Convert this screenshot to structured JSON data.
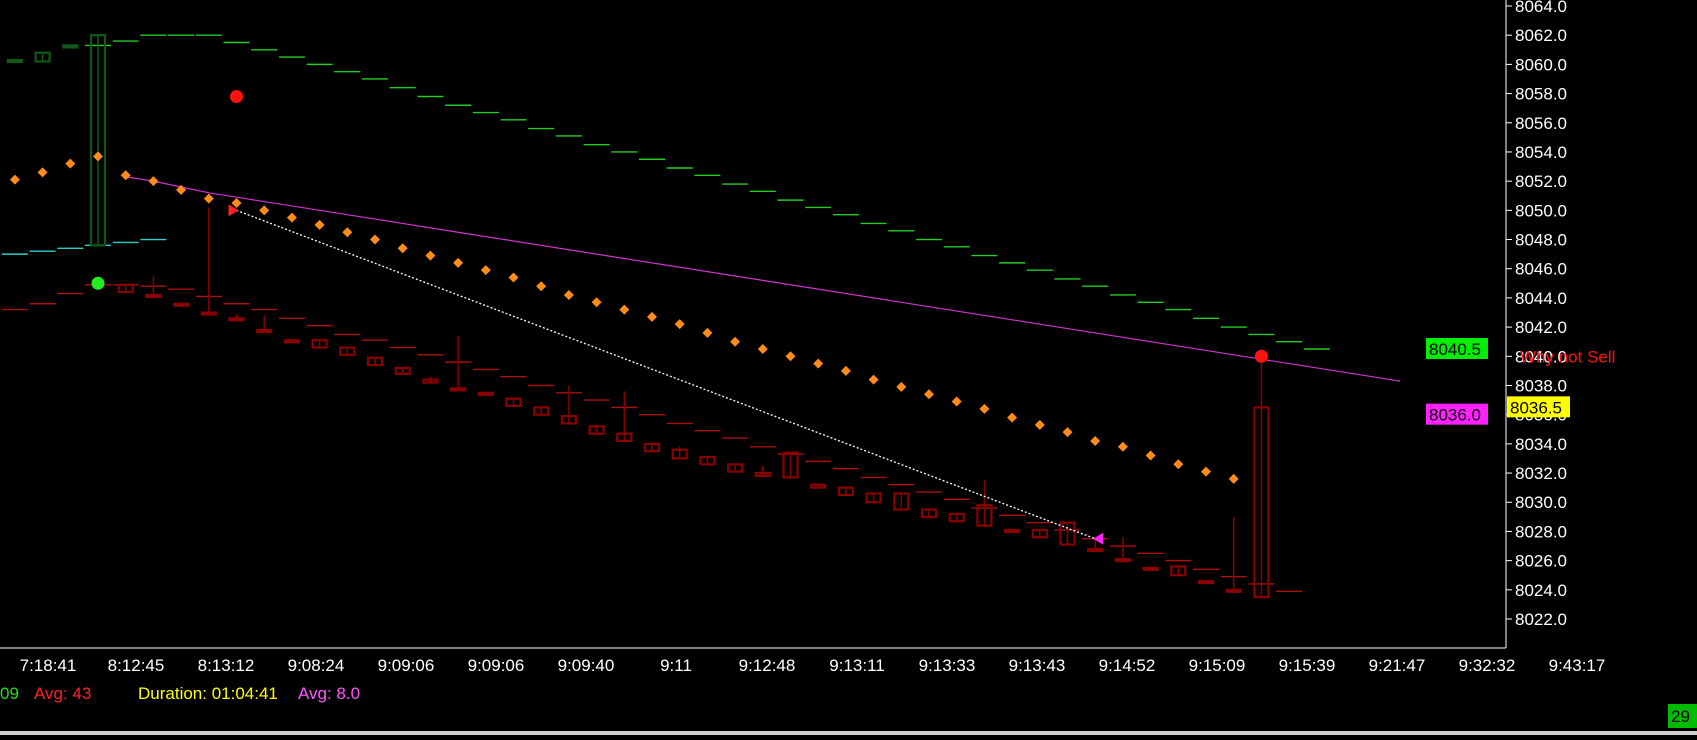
{
  "chart_data": {
    "type": "candlestick",
    "ylim": [
      8021,
      8065
    ],
    "y_ticks": [
      "8022.0",
      "8024.0",
      "8026.0",
      "8028.0",
      "8030.0",
      "8032.0",
      "8034.0",
      "8036.0",
      "8038.0",
      "8040.0",
      "8042.0",
      "8044.0",
      "8046.0",
      "8048.0",
      "8050.0",
      "8052.0",
      "8054.0",
      "8056.0",
      "8058.0",
      "8060.0",
      "8062.0",
      "8064.0"
    ],
    "x_ticks": [
      "7:18:41",
      "8:12:45",
      "8:13:12",
      "9:08:24",
      "9:09:06",
      "9:09:06",
      "9:09:40",
      "9:11",
      "9:12:48",
      "9:13:11",
      "9:13:33",
      "9:13:43",
      "9:14:52",
      "9:15:09",
      "9:15:39",
      "9:21:47",
      "9:32:32",
      "9:43:17"
    ],
    "bars": [
      {
        "o": 8060.3,
        "h": 8060.3,
        "l": 8060.3,
        "c": 8060.3,
        "color": "#0f5a18"
      },
      {
        "o": 8060.2,
        "h": 8060.8,
        "l": 8060.2,
        "c": 8060.8,
        "color": "#0f5a18"
      },
      {
        "o": 8061.3,
        "h": 8061.3,
        "l": 8061.3,
        "c": 8061.3,
        "color": "#0f5a18"
      },
      {
        "o": 8047.6,
        "h": 8062.0,
        "l": 8047.6,
        "c": 8062.0,
        "color": "#0f5a18"
      },
      {
        "o": 8044.9,
        "h": 8044.9,
        "l": 8044.4,
        "c": 8044.4,
        "color": "#8b0000"
      },
      {
        "o": 8044.2,
        "h": 8045.5,
        "l": 8044.2,
        "c": 8044.2,
        "color": "#8b0000"
      },
      {
        "o": 8043.6,
        "h": 8043.6,
        "l": 8043.6,
        "c": 8043.6,
        "color": "#8b0000"
      },
      {
        "o": 8043.0,
        "h": 8050.2,
        "l": 8043.0,
        "c": 8043.0,
        "color": "#8b0000"
      },
      {
        "o": 8042.6,
        "h": 8042.9,
        "l": 8042.6,
        "c": 8042.6,
        "color": "#8b0000"
      },
      {
        "o": 8041.8,
        "h": 8042.8,
        "l": 8041.8,
        "c": 8041.8,
        "color": "#8b0000"
      },
      {
        "o": 8041.1,
        "h": 8041.1,
        "l": 8041.1,
        "c": 8041.1,
        "color": "#8b0000"
      },
      {
        "o": 8041.1,
        "h": 8041.1,
        "l": 8040.6,
        "c": 8040.6,
        "color": "#8b0000"
      },
      {
        "o": 8040.6,
        "h": 8040.6,
        "l": 8040.1,
        "c": 8040.1,
        "color": "#8b0000"
      },
      {
        "o": 8039.9,
        "h": 8039.9,
        "l": 8039.4,
        "c": 8039.4,
        "color": "#8b0000"
      },
      {
        "o": 8039.2,
        "h": 8039.2,
        "l": 8038.8,
        "c": 8038.8,
        "color": "#8b0000"
      },
      {
        "o": 8038.4,
        "h": 8038.6,
        "l": 8038.2,
        "c": 8038.2,
        "color": "#8b0000"
      },
      {
        "o": 8037.8,
        "h": 8041.4,
        "l": 8037.8,
        "c": 8037.8,
        "color": "#8b0000"
      },
      {
        "o": 8037.5,
        "h": 8037.5,
        "l": 8037.5,
        "c": 8037.5,
        "color": "#8b0000"
      },
      {
        "o": 8037.1,
        "h": 8037.1,
        "l": 8036.6,
        "c": 8036.6,
        "color": "#8b0000"
      },
      {
        "o": 8036.5,
        "h": 8036.5,
        "l": 8036.0,
        "c": 8036.0,
        "color": "#8b0000"
      },
      {
        "o": 8035.9,
        "h": 8038.0,
        "l": 8035.4,
        "c": 8035.4,
        "color": "#8b0000"
      },
      {
        "o": 8035.2,
        "h": 8035.2,
        "l": 8034.7,
        "c": 8034.7,
        "color": "#8b0000"
      },
      {
        "o": 8034.7,
        "h": 8037.6,
        "l": 8034.2,
        "c": 8034.2,
        "color": "#8b0000"
      },
      {
        "o": 8034.0,
        "h": 8034.0,
        "l": 8033.5,
        "c": 8033.5,
        "color": "#8b0000"
      },
      {
        "o": 8033.6,
        "h": 8033.8,
        "l": 8033.0,
        "c": 8033.0,
        "color": "#8b0000"
      },
      {
        "o": 8033.1,
        "h": 8033.1,
        "l": 8032.6,
        "c": 8032.6,
        "color": "#8b0000"
      },
      {
        "o": 8032.6,
        "h": 8032.6,
        "l": 8032.1,
        "c": 8032.1,
        "color": "#8b0000"
      },
      {
        "o": 8032.0,
        "h": 8032.5,
        "l": 8031.8,
        "c": 8031.8,
        "color": "#8b0000"
      },
      {
        "o": 8033.4,
        "h": 8033.4,
        "l": 8031.7,
        "c": 8031.7,
        "color": "#8b0000"
      },
      {
        "o": 8031.2,
        "h": 8031.2,
        "l": 8031.0,
        "c": 8031.0,
        "color": "#8b0000"
      },
      {
        "o": 8031.0,
        "h": 8031.0,
        "l": 8030.5,
        "c": 8030.5,
        "color": "#8b0000"
      },
      {
        "o": 8030.6,
        "h": 8030.6,
        "l": 8030.0,
        "c": 8030.0,
        "color": "#8b0000"
      },
      {
        "o": 8030.6,
        "h": 8030.6,
        "l": 8029.5,
        "c": 8029.5,
        "color": "#8b0000"
      },
      {
        "o": 8029.5,
        "h": 8029.5,
        "l": 8029.0,
        "c": 8029.0,
        "color": "#8b0000"
      },
      {
        "o": 8029.2,
        "h": 8029.2,
        "l": 8028.7,
        "c": 8028.7,
        "color": "#8b0000"
      },
      {
        "o": 8029.8,
        "h": 8031.5,
        "l": 8028.4,
        "c": 8028.4,
        "color": "#8b0000"
      },
      {
        "o": 8028.1,
        "h": 8028.1,
        "l": 8028.1,
        "c": 8028.1,
        "color": "#8b0000"
      },
      {
        "o": 8028.1,
        "h": 8028.1,
        "l": 8027.6,
        "c": 8027.6,
        "color": "#8b0000"
      },
      {
        "o": 8028.6,
        "h": 8028.6,
        "l": 8027.1,
        "c": 8027.1,
        "color": "#8b0000"
      },
      {
        "o": 8026.8,
        "h": 8027.6,
        "l": 8026.8,
        "c": 8026.8,
        "color": "#8b0000"
      },
      {
        "o": 8026.1,
        "h": 8027.6,
        "l": 8026.1,
        "c": 8026.1,
        "color": "#8b0000"
      },
      {
        "o": 8025.5,
        "h": 8025.5,
        "l": 8025.5,
        "c": 8025.5,
        "color": "#8b0000"
      },
      {
        "o": 8025.6,
        "h": 8025.6,
        "l": 8025.0,
        "c": 8025.0,
        "color": "#8b0000"
      },
      {
        "o": 8024.6,
        "h": 8024.6,
        "l": 8024.6,
        "c": 8024.6,
        "color": "#8b0000"
      },
      {
        "o": 8024.0,
        "h": 8029.0,
        "l": 8024.0,
        "c": 8024.0,
        "color": "#8b0000"
      },
      {
        "o": 8036.5,
        "h": 8040.0,
        "l": 8023.5,
        "c": 8023.5,
        "color": "#8b0000"
      }
    ],
    "upper_band": [
      8061.3,
      8061.6,
      8062.0,
      8062.0,
      8062.0,
      8061.5,
      8061.0,
      8060.5,
      8060.0,
      8059.5,
      8059.0,
      8058.4,
      8057.8,
      8057.2,
      8056.7,
      8056.2,
      8055.6,
      8055.1,
      8054.5,
      8054.0,
      8053.5,
      8052.9,
      8052.4,
      8051.8,
      8051.3,
      8050.7,
      8050.2,
      8049.7,
      8049.1,
      8048.6,
      8048.0,
      8047.5,
      8046.9,
      8046.4,
      8045.9,
      8045.3,
      8044.8,
      8044.2,
      8043.7,
      8043.2,
      8042.6,
      8042.0,
      8041.5,
      8041.0,
      8040.5
    ],
    "lower_band": [
      8043.2,
      8043.6,
      8044.3,
      8044.9,
      8044.9,
      8044.8,
      8044.6,
      8044.1,
      8043.6,
      8043.2,
      8042.6,
      8042.1,
      8041.5,
      8041.1,
      8040.6,
      8040.1,
      8039.6,
      8039.1,
      8038.6,
      8038.0,
      8037.5,
      8037.0,
      8036.5,
      8036.0,
      8035.4,
      8034.9,
      8034.4,
      8033.8,
      8033.3,
      8032.8,
      8032.3,
      8031.7,
      8031.2,
      8030.7,
      8030.2,
      8029.6,
      8029.1,
      8028.6,
      8028.1,
      8027.5,
      8027.0,
      8026.5,
      8026.0,
      8025.4,
      8024.9,
      8024.4,
      8023.9
    ],
    "midline": [
      8052.3,
      8052.0,
      8051.6,
      8051.2,
      8050.9,
      8050.6,
      8050.3,
      8050.0,
      8049.7,
      8049.4,
      8049.1,
      8048.8,
      8048.5,
      8048.2,
      8047.9,
      8047.6,
      8047.3,
      8047.0,
      8046.7,
      8046.4,
      8046.1,
      8045.8,
      8045.5,
      8045.2,
      8044.9,
      8044.6,
      8044.3,
      8044.0,
      8043.7,
      8043.4,
      8043.1,
      8042.8,
      8042.5,
      8042.2,
      8041.9,
      8041.6,
      8041.3,
      8041.0,
      8040.7,
      8040.4,
      8040.1,
      8039.8,
      8039.5,
      8039.2,
      8038.9,
      8038.6,
      8038.3
    ],
    "cyan_line": [
      8047.0,
      8047.2,
      8047.4,
      8047.6,
      8047.8,
      8048.0
    ],
    "dots": [
      8052.1,
      8052.6,
      8053.2,
      8053.7,
      8052.4,
      8052.0,
      8051.4,
      8050.8,
      8050.5,
      8050.0,
      8049.5,
      8049.0,
      8048.5,
      8048.0,
      8047.4,
      8046.9,
      8046.4,
      8045.9,
      8045.4,
      8044.8,
      8044.2,
      8043.7,
      8043.2,
      8042.7,
      8042.2,
      8041.6,
      8041.0,
      8040.5,
      8040.0,
      8039.5,
      8039.0,
      8038.4,
      8037.9,
      8037.4,
      8036.9,
      8036.4,
      8035.8,
      8035.3,
      8034.8,
      8034.2,
      8033.8,
      8033.2,
      8032.6,
      8032.1,
      8031.6
    ],
    "trade_line": {
      "from": {
        "bar": 8,
        "y": 8050.0
      },
      "to": {
        "bar": 39,
        "y": 8027.5
      }
    },
    "markers": [
      {
        "bar": 3,
        "y": 8045.0,
        "color": "#22ee22",
        "kind": "dot"
      },
      {
        "bar": 8,
        "y": 8057.8,
        "color": "#ff1111",
        "kind": "dot"
      },
      {
        "bar": 45,
        "y": 8040.0,
        "color": "#ff1111",
        "kind": "dot"
      },
      {
        "bar": 8,
        "y": 8050.0,
        "color": "#ff2222",
        "kind": "arrow-right"
      },
      {
        "bar": 39,
        "y": 8027.5,
        "color": "#ff22ff",
        "kind": "arrow-left"
      }
    ],
    "price_tags": [
      {
        "text": "8040.5",
        "y": 8040.5,
        "bg": "#00ee00",
        "fg": "#000000",
        "position": "inline"
      },
      {
        "text": "8036.0",
        "y": 8036.0,
        "bg": "#ff22ff",
        "fg": "#000000",
        "position": "inline"
      },
      {
        "text": "8036.5",
        "y": 8036.5,
        "bg": "#ffff00",
        "fg": "#000000",
        "position": "axis"
      }
    ],
    "annotation": {
      "text": "Why not Sell",
      "y": 8040.0,
      "color": "#ff1111"
    }
  },
  "status_line": [
    {
      "text": "09",
      "color": "#22dd22"
    },
    {
      "text": "Avg: 43",
      "color": "#ff2222"
    },
    {
      "text": "Duration: 01:04:41",
      "color": "#ffff00"
    },
    {
      "text": "Avg: 8.0",
      "color": "#ff55ff"
    }
  ],
  "corner_badge": {
    "text": "29",
    "bg": "#00bb00",
    "fg": "#000000"
  },
  "colors": {
    "background": "#000000",
    "axis": "#ffffff",
    "upper_band": "#22cc22",
    "lower_band": "#aa1111",
    "midline": "#cc33cc",
    "cyan_line": "#33cccc",
    "dots": "#ff8c1a",
    "trade_line": "#ffffff"
  }
}
